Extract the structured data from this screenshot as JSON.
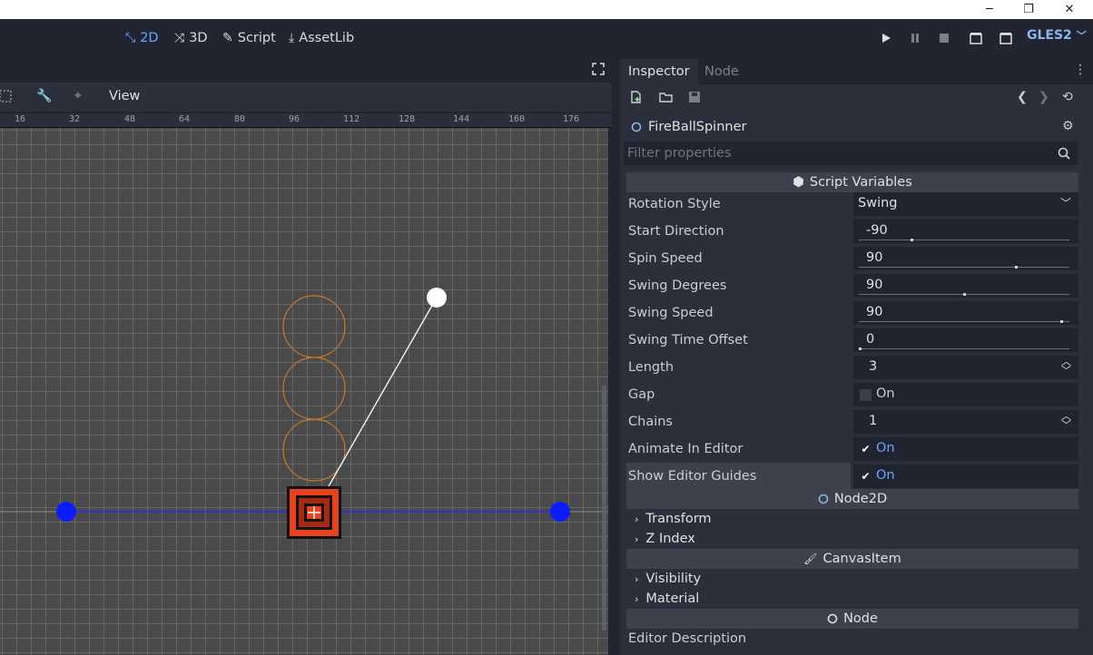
{
  "window": {
    "minimize_icon": "─",
    "restore_icon": "❐",
    "close_icon": "✕"
  },
  "topbar": {
    "modes": [
      {
        "label": "2D",
        "icon": "⤡"
      },
      {
        "label": "3D",
        "icon": "⤨"
      },
      {
        "label": "Script",
        "icon": "✎"
      },
      {
        "label": "AssetLib",
        "icon": "⤓"
      }
    ],
    "renderer": "GLES2"
  },
  "viewport": {
    "menu": "View",
    "ruler_labels": [
      "16",
      "32",
      "48",
      "64",
      "80",
      "96",
      "112",
      "128",
      "144",
      "160",
      "176"
    ]
  },
  "inspector": {
    "tabs": [
      "Inspector",
      "Node"
    ],
    "node_name": "FireBallSpinner",
    "filter_placeholder": "Filter properties",
    "script_section": "Script Variables",
    "properties": [
      {
        "label": "Rotation Style",
        "value": "Swing",
        "kind": "select"
      },
      {
        "label": "Start Direction",
        "value": "-90",
        "kind": "slider",
        "level": 0.25
      },
      {
        "label": "Spin Speed",
        "value": "90",
        "kind": "slider",
        "level": 0.75
      },
      {
        "label": "Swing Degrees",
        "value": "90",
        "kind": "slider",
        "level": 0.5
      },
      {
        "label": "Swing Speed",
        "value": "90",
        "kind": "slider",
        "level": 0.97
      },
      {
        "label": "Swing Time Offset",
        "value": "0",
        "kind": "slider",
        "level": 0.0
      },
      {
        "label": "Length",
        "value": "3",
        "kind": "spin"
      },
      {
        "label": "Gap",
        "value": "On",
        "kind": "check",
        "checked": false
      },
      {
        "label": "Chains",
        "value": "1",
        "kind": "spin"
      },
      {
        "label": "Animate In Editor",
        "value": "On",
        "kind": "check",
        "checked": true
      },
      {
        "label": "Show Editor Guides",
        "value": "On",
        "kind": "check",
        "checked": true
      }
    ],
    "node2d_section": "Node2D",
    "node2d_groups": [
      "Transform",
      "Z Index"
    ],
    "canvasitem_section": "CanvasItem",
    "canvasitem_groups": [
      "Visibility",
      "Material"
    ],
    "node_section": "Node",
    "node_property": "Editor Description"
  },
  "colors": {
    "accent": "#6ba5ff",
    "checked_on": "#6ba5ff"
  }
}
